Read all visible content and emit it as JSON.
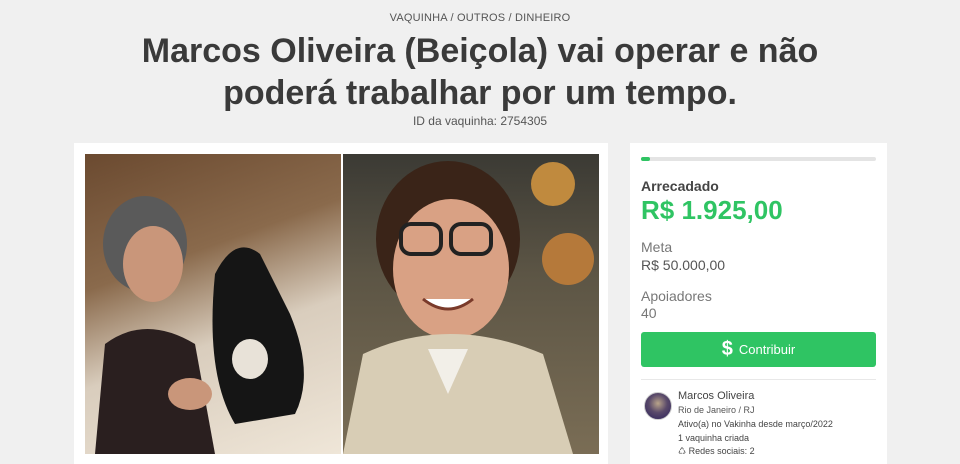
{
  "breadcrumb": "VAQUINHA / OUTROS / DINHEIRO",
  "title": "Marcos Oliveira (Beiçola) vai operar e não poderá trabalhar por um tempo.",
  "campaign_id": "ID da vaquinha: 2754305",
  "sidebar": {
    "progress_fraction": 0.04,
    "raised_label": "Arrecadado",
    "raised_amount": "R$ 1.925,00",
    "goal_label": "Meta",
    "goal_amount": "R$ 50.000,00",
    "supporters_label": "Apoiadores",
    "supporters_count": "40",
    "contribute_label": "Contribuir",
    "contribute_icon": "$",
    "accent_color": "#2fc463"
  },
  "author": {
    "name": "Marcos Oliveira",
    "location": "Rio de Janeiro / RJ",
    "active_since": "Ativo(a) no Vakinha desde março/2022",
    "campaigns": "1 vaquinha criada",
    "social": "♺ Redes sociais: 2"
  }
}
